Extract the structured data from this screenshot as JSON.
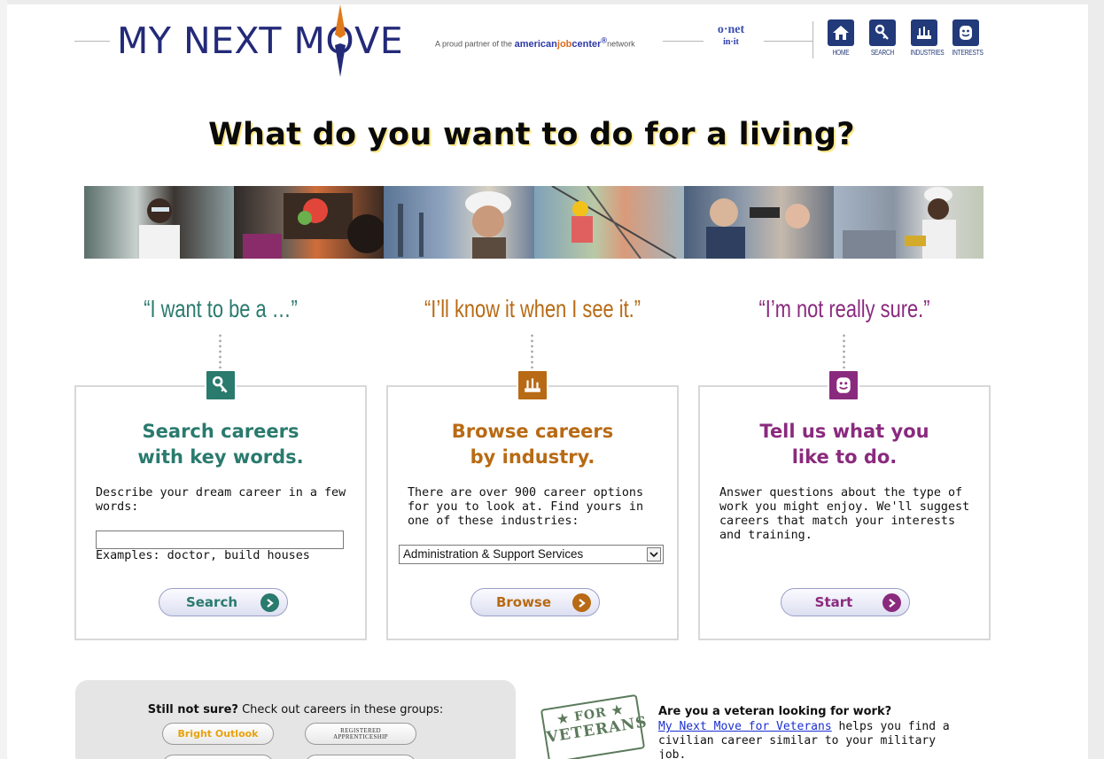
{
  "header": {
    "logo_part1": "MY NEXT M",
    "logo_o": "O",
    "logo_part2": "VE",
    "partner_prefix": "A proud partner of the",
    "partner_brand_a": "american",
    "partner_brand_b": "job",
    "partner_brand_c": "center",
    "partner_reg": "®",
    "partner_suffix": "network",
    "onet_top": "o·net",
    "onet_bottom": "in·it",
    "nav": [
      {
        "label": "HOME",
        "icon": "home-icon"
      },
      {
        "label": "SEARCH",
        "icon": "key-icon"
      },
      {
        "label": "INDUSTRIES",
        "icon": "industry-icon"
      },
      {
        "label": "INTERESTS",
        "icon": "face-icon"
      }
    ]
  },
  "headline": "What do you want to do for a living?",
  "columns": [
    {
      "quote": "“I want to be a …”",
      "color": "#2a7a6e",
      "title_line1": "Search careers",
      "title_line2": "with key words.",
      "text": "Describe your dream career in a few words:",
      "input_value": "",
      "examples": "Examples: doctor, build houses",
      "button": "Search"
    },
    {
      "quote": "“I’ll know it when I see it.”",
      "color": "#b86a14",
      "title_line1": "Browse careers",
      "title_line2": "by industry.",
      "text": "There are over 900 career options for you to look at. Find yours in one of these industries:",
      "select_value": "Administration & Support Services",
      "button": "Browse"
    },
    {
      "quote": "“I’m not really sure.”",
      "color": "#8a2a7e",
      "title_line1": "Tell us what you",
      "title_line2": "like to do.",
      "text": "Answer questions about the type of work you might enjoy. We'll suggest careers that match your interests and training.",
      "button": "Start"
    }
  ],
  "groups": {
    "bold": "Still not sure?",
    "rest": " Check out careers in these groups:",
    "bright_outlook": "Bright Outlook",
    "registered_line1": "REGISTERED",
    "registered_line2": "APPRENTICESHIP"
  },
  "veterans": {
    "stamp_line1": "★ FOR ★",
    "stamp_line2": "VETERANS",
    "title": "Are you a veteran looking for work?",
    "link": "My Next Move for Veterans",
    "text": " helps you find a civilian career similar to your military job."
  }
}
